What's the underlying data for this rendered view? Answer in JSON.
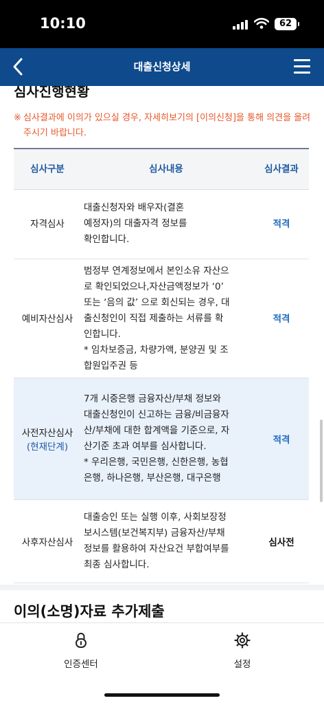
{
  "status_bar": {
    "time": "10:10",
    "battery": "62"
  },
  "header": {
    "title": "대출신청상세"
  },
  "section": {
    "title": "심사진행현황",
    "notice_mark": "※",
    "notice": "심사결과에 이의가 있으실 경우, 자세히보기의 [이의신청]을 통해 의견을 올려주시기 바랍니다."
  },
  "table": {
    "headers": [
      "심사구분",
      "심사내용",
      "심사결과"
    ],
    "rows": [
      {
        "category": "자격심사",
        "sub": "",
        "lines": [
          "대출신청자와 배우자(결혼",
          "예정자)의 대출자격 정보를",
          "확인합니다."
        ],
        "result": "적격"
      },
      {
        "category": "예비자산심사",
        "sub": "",
        "lines": [
          "범정부 연계정보에서 본인소유 자산으",
          "로 확인되었으나,자산금액정보가 ‘0’",
          "또는 ‘음의 값’ 으로 회신되는 경우, 대",
          "출신청인이 직접 제출하는 서류를 확",
          "인합니다.",
          "* 임차보증금, 차량가액, 분양권 및 조",
          "합원입주권 등"
        ],
        "result": "적격"
      },
      {
        "category": "사전자산심사",
        "sub": "(현재단계)",
        "lines": [
          "7개 시중은행 금융자산/부채 정보와",
          "대출신청인이 신고하는 금융/비금융자",
          "산/부채에 대한 합계액을 기준으로, 자",
          "산기준 초과 여부를 심사합니다.",
          "* 우리은행, 국민은행, 신한은행, 농협",
          "은행, 하나은행, 부산은행, 대구은행"
        ],
        "result": "적격"
      },
      {
        "category": "사후자산심사",
        "sub": "",
        "lines": [
          "대출승인 또는 실행 이후, 사회보장정",
          "보시스템(보건복지부) 금융자산/부채",
          "정보를 활용하여 자산요건 부합여부를",
          "최종 심사합니다."
        ],
        "result": "심사전"
      }
    ]
  },
  "section2": {
    "title": "이의(소명)자료 추가제출"
  },
  "tabs": [
    {
      "label": "인증센터",
      "icon": "lock-icon"
    },
    {
      "label": "설정",
      "icon": "gear-icon"
    }
  ],
  "colors": {
    "header": "#0e4a8c",
    "notice": "#e8572a",
    "accent": "#1f6bc0",
    "current_row": "#e9f1fb"
  }
}
